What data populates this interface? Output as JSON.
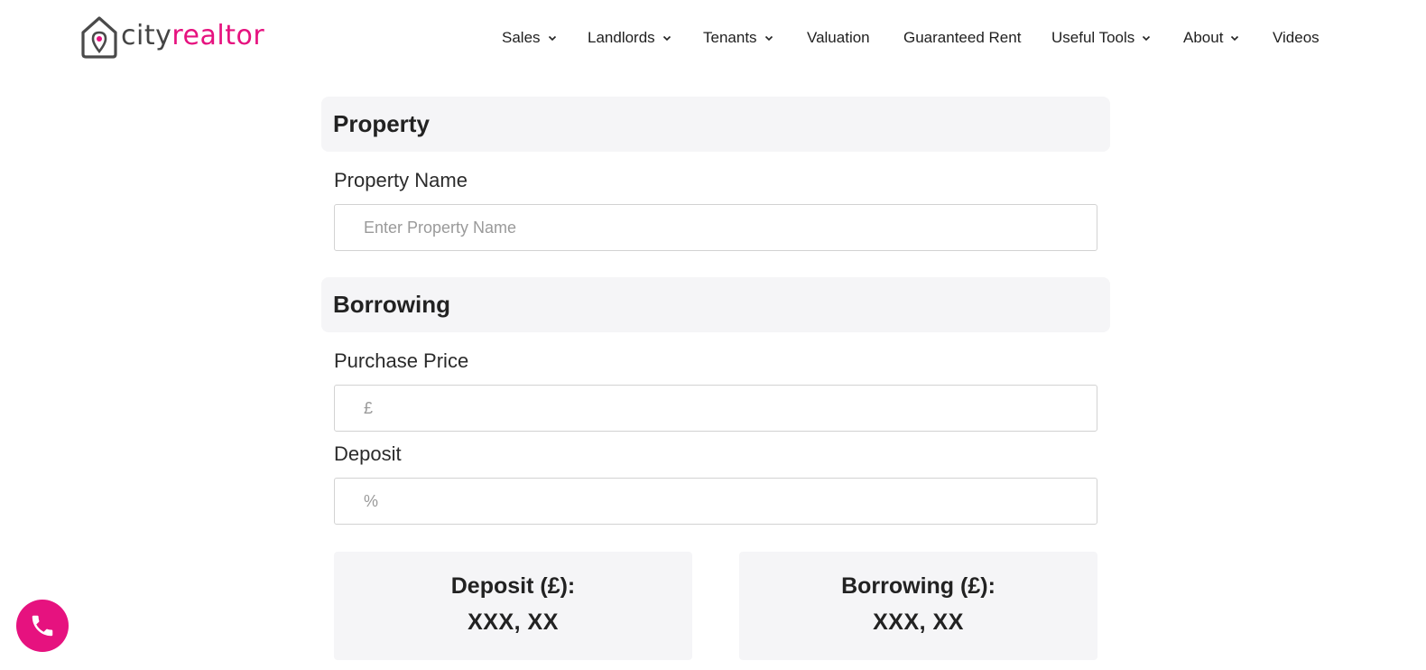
{
  "brand": {
    "name_part1": "city",
    "name_part2": "realtor",
    "accent_color": "#e6127f",
    "icon": "house-pin-logo-icon"
  },
  "nav": {
    "items": [
      {
        "label": "Sales",
        "dropdown": true
      },
      {
        "label": "Landlords",
        "dropdown": true
      },
      {
        "label": "Tenants",
        "dropdown": true
      },
      {
        "label": "Valuation",
        "dropdown": false
      },
      {
        "label": "Guaranteed Rent",
        "dropdown": false
      },
      {
        "label": "Useful Tools",
        "dropdown": true
      },
      {
        "label": "About",
        "dropdown": true
      },
      {
        "label": "Videos",
        "dropdown": false
      }
    ]
  },
  "form": {
    "property_section": {
      "title": "Property",
      "name_label": "Property Name",
      "name_placeholder": "Enter Property Name",
      "name_value": ""
    },
    "borrowing_section": {
      "title": "Borrowing",
      "purchase_price_label": "Purchase Price",
      "purchase_price_placeholder": "£",
      "purchase_price_value": "",
      "deposit_label": "Deposit",
      "deposit_placeholder": "%",
      "deposit_value": ""
    },
    "results": {
      "deposit_label": "Deposit (£):",
      "deposit_value": "XXX, XX",
      "borrowing_label": "Borrowing (£):",
      "borrowing_value": "XXX, XX"
    }
  },
  "floating": {
    "call_icon": "phone-icon",
    "call_color": "#e6127f"
  }
}
